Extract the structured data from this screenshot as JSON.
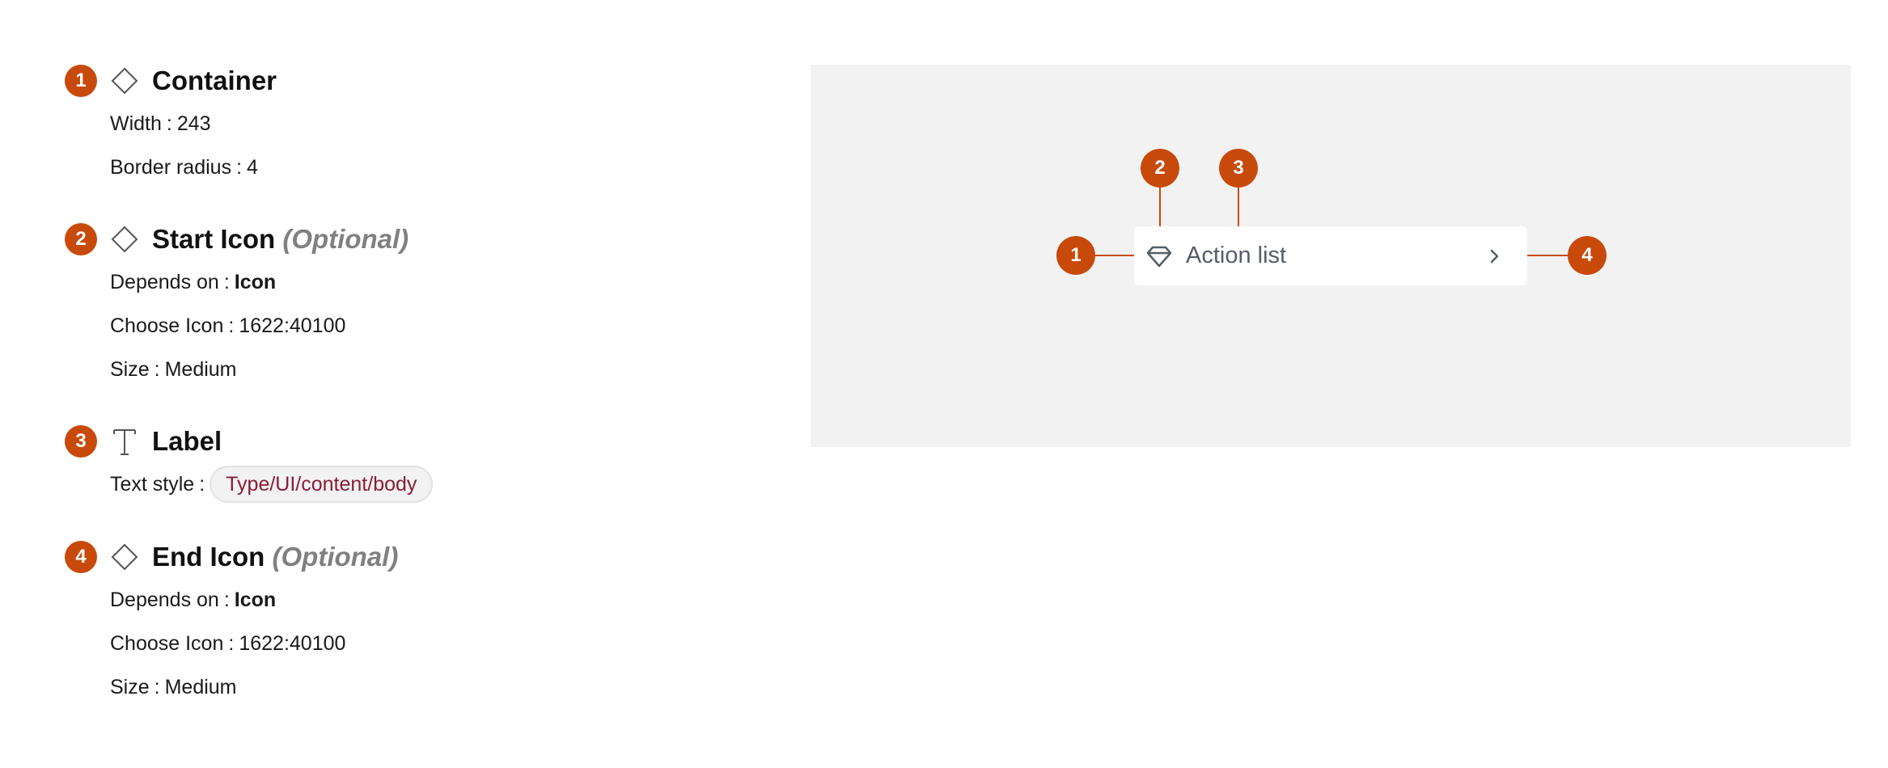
{
  "sections": [
    {
      "number": "1",
      "icon": "diamond-icon",
      "title": "Container",
      "properties": [
        {
          "label": "Width",
          "value": "243"
        },
        {
          "label": "Border radius",
          "value": "4"
        }
      ]
    },
    {
      "number": "2",
      "icon": "diamond-icon",
      "title": "Start Icon",
      "optional": "(Optional)",
      "properties": [
        {
          "label": "Depends on",
          "value": "Icon"
        },
        {
          "label": "Choose Icon",
          "value": "1622:40100"
        },
        {
          "label": "Size",
          "value": "Medium"
        }
      ]
    },
    {
      "number": "3",
      "icon": "text-icon",
      "title": "Label",
      "properties": [
        {
          "label": "Text style",
          "value": "Type/UI/content/body"
        }
      ]
    },
    {
      "number": "4",
      "icon": "diamond-icon",
      "title": "End Icon",
      "optional": "(Optional)",
      "properties": [
        {
          "label": "Depends on",
          "value": "Icon"
        },
        {
          "label": "Choose Icon",
          "value": "1622:40100"
        },
        {
          "label": "Size",
          "value": "Medium"
        }
      ]
    }
  ],
  "separator": ":",
  "preview": {
    "component_label": "Action list",
    "start_icon": "gem-icon",
    "end_icon": "chevron-right-icon",
    "markers": [
      "1",
      "2",
      "3",
      "4"
    ]
  },
  "colors": {
    "badge": "#c84a0b",
    "preview_bg": "#f2f2f2",
    "optional_text": "#808080",
    "chip_text": "#8b1c38"
  }
}
